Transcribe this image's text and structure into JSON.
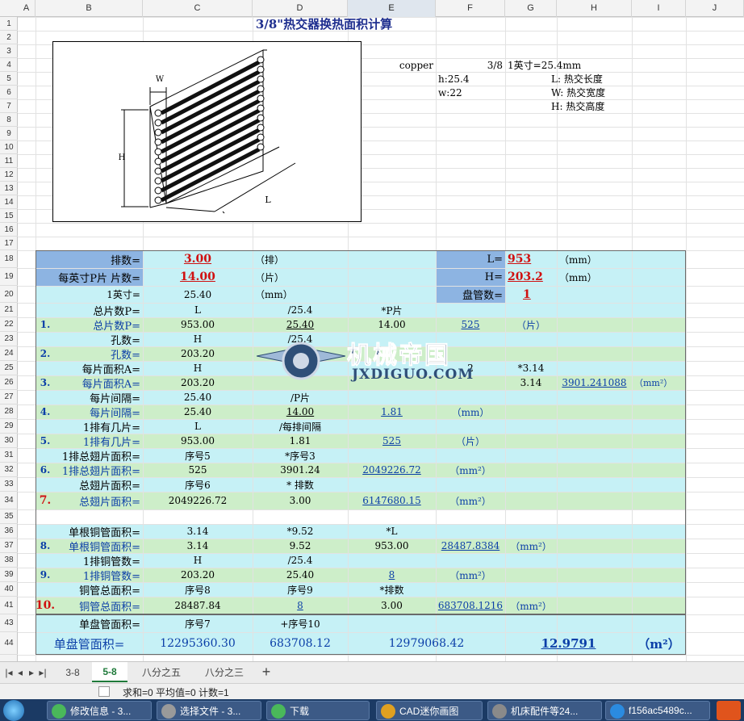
{
  "columns": [
    "A",
    "B",
    "C",
    "D",
    "E",
    "F",
    "G",
    "H",
    "I",
    "J"
  ],
  "rows": [
    "1",
    "2",
    "3",
    "4",
    "5",
    "6",
    "7",
    "8",
    "9",
    "10",
    "11",
    "12",
    "13",
    "14",
    "15",
    "16",
    "17",
    "18",
    "19",
    "20",
    "21",
    "22",
    "23",
    "24",
    "25",
    "26",
    "27",
    "28",
    "29",
    "30",
    "31",
    "32",
    "33",
    "34",
    "35",
    "36",
    "37",
    "38",
    "39",
    "40",
    "41",
    "43",
    "44"
  ],
  "title": "3/8\"热交器换热面积计算",
  "info": {
    "copper": "copper",
    "size": "3/8",
    "h": "h:25.4",
    "w": "w:22",
    "inch": "1英寸=25.4mm",
    "L": "L: 热交长度",
    "W": "W: 热交宽度",
    "H": "H: 热交高度"
  },
  "diagram": {
    "w": "W",
    "h": "H",
    "l": "L"
  },
  "params": {
    "rows_label": "排数=",
    "rows_value": "3.00",
    "rows_unit": "（排）",
    "fpi_label": "每英寸P片 片数=",
    "fpi_value": "14.00",
    "fpi_unit": "（片）",
    "inch_label": "1英寸=",
    "inch_value": "25.40",
    "inch_unit": "（mm）",
    "L_label": "L=",
    "L_value": "953",
    "L_unit": "（mm）",
    "H_label": "H=",
    "H_value": "203.2",
    "H_unit": "（mm）",
    "coil_label": "盘管数=",
    "coil_value": "1"
  },
  "calc": [
    {
      "row": "21",
      "B": "总片数P=",
      "C": "L",
      "D": "/25.4",
      "E": "*P片",
      "F": "",
      "G": ""
    },
    {
      "row": "22",
      "n": "1.",
      "B": "总片数P=",
      "C": "953.00",
      "D": "25.40",
      "E": "14.00",
      "F": "525",
      "G": "（片）"
    },
    {
      "row": "23",
      "B": "孔数=",
      "C": "H",
      "D": "/25.4",
      "E": "",
      "F": "",
      "G": ""
    },
    {
      "row": "24",
      "n": "2.",
      "B": "孔数=",
      "C": "203.20",
      "D": "",
      "E": "",
      "F": "",
      "G": ""
    },
    {
      "row": "25",
      "B": "每片面积A=",
      "C": "H",
      "D": "",
      "E": "",
      "F": "2",
      "G": "*3.14"
    },
    {
      "row": "26",
      "n": "3.",
      "B": "每片面积A=",
      "C": "203.20",
      "D": "",
      "E": "",
      "F": "",
      "G": "3.14",
      "H": "3901.241088",
      "I": "（mm²）"
    },
    {
      "row": "27",
      "B": "每片间隔=",
      "C": "25.40",
      "D": "/P片",
      "E": "",
      "F": "",
      "G": ""
    },
    {
      "row": "28",
      "n": "4.",
      "B": "每片间隔=",
      "C": "25.40",
      "D": "14.00",
      "E": "1.81",
      "F": "（mm）",
      "G": ""
    },
    {
      "row": "29",
      "B": "1排有几片=",
      "C": "L",
      "D": "/每排间隔",
      "E": "",
      "F": "",
      "G": ""
    },
    {
      "row": "30",
      "n": "5.",
      "B": "1排有几片=",
      "C": "953.00",
      "D": "1.81",
      "E": "525",
      "F": "（片）",
      "G": ""
    },
    {
      "row": "31",
      "B": "1排总翅片面积=",
      "C": "序号5",
      "D": "*序号3",
      "E": "",
      "F": "",
      "G": ""
    },
    {
      "row": "32",
      "n": "6.",
      "B": "1排总翅片面积=",
      "C": "525",
      "D": "3901.24",
      "E": "2049226.72",
      "F": "（mm²）",
      "G": ""
    },
    {
      "row": "33",
      "B": "总翅片面积=",
      "C": "序号6",
      "D": "* 排数",
      "E": "",
      "F": "",
      "G": ""
    },
    {
      "row": "34",
      "n": "7.",
      "B": "总翅片面积=",
      "C": "2049226.72",
      "D": "3.00",
      "E": "6147680.15",
      "F": "（mm²）",
      "G": ""
    },
    {
      "row": "36",
      "B": "单根铜管面积=",
      "C": "3.14",
      "D": "*9.52",
      "E": "*L",
      "F": "",
      "G": ""
    },
    {
      "row": "37",
      "n": "8.",
      "B": "单根铜管面积=",
      "C": "3.14",
      "D": "9.52",
      "E": "953.00",
      "F": "28487.8384",
      "G": "（mm²）"
    },
    {
      "row": "38",
      "B": "1排铜管数=",
      "C": "H",
      "D": "/25.4",
      "E": "",
      "F": "",
      "G": ""
    },
    {
      "row": "39",
      "n": "9.",
      "B": "1排铜管数=",
      "C": "203.20",
      "D": "25.40",
      "E": "8",
      "F": "（mm²）",
      "G": ""
    },
    {
      "row": "40",
      "B": "铜管总面积=",
      "C": "序号8",
      "D": "序号9",
      "E": "*排数",
      "F": "",
      "G": ""
    },
    {
      "row": "41",
      "n": "10.",
      "B": "铜管总面积=",
      "C": "28487.84",
      "D": "8",
      "E": "3.00",
      "F": "683708.1216",
      "G": "（mm²）"
    }
  ],
  "total": {
    "label43": "单盘管面积=",
    "c43": "序号7",
    "d43": "+序号10",
    "label44": "单盘管面积=",
    "c44": "12295360.30",
    "d44": "683708.12",
    "e44": "12979068.42",
    "g44": "12.9791",
    "unit": "（m²）"
  },
  "watermark": {
    "text": "机械帝国",
    "sub": "JXDIGUO.COM"
  },
  "sheets": [
    "3-8",
    "5-8",
    "八分之五",
    "八分之三"
  ],
  "active_sheet": "5-8",
  "status": "求和=0  平均值=0  计数=1",
  "taskbar": [
    {
      "label": "修改信息 - 3..."
    },
    {
      "label": "选择文件 - 3..."
    },
    {
      "label": "下载"
    },
    {
      "label": "CAD迷你画图"
    },
    {
      "label": "机床配件等24..."
    },
    {
      "label": "f156ac5489c..."
    }
  ],
  "colors": {
    "header_blue": "#8db4e2",
    "light_green": "#cdeec9",
    "light_cyan": "#c6f1f6",
    "title": "#1f2f8f"
  }
}
